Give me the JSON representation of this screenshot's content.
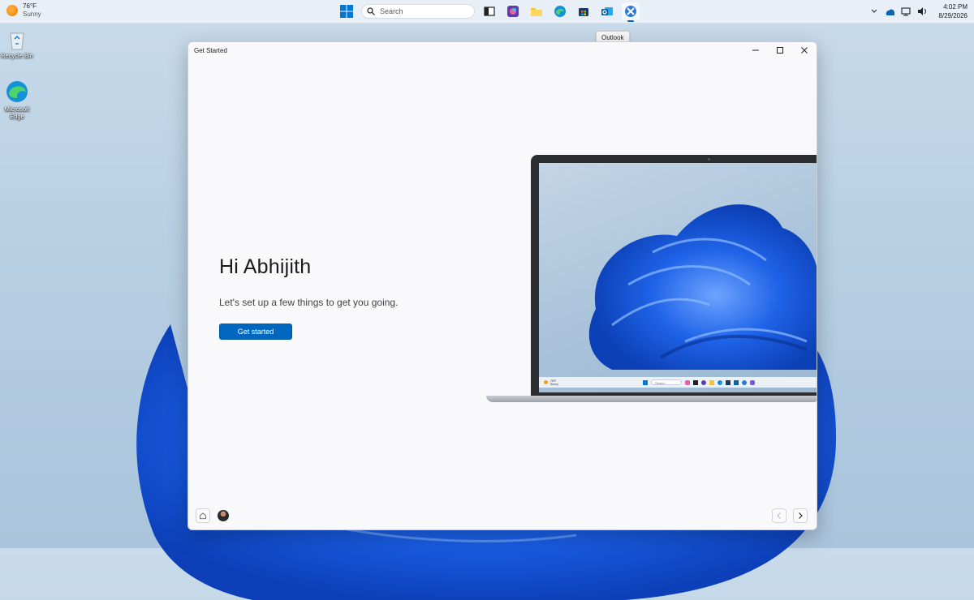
{
  "taskbar": {
    "weather": {
      "temp": "76°F",
      "condition": "Sunny"
    },
    "search": {
      "placeholder": "Search"
    },
    "clock": {
      "time": "4:02 PM",
      "date": "8/29/2026"
    },
    "tooltip": "Outlook"
  },
  "desktop": {
    "icons": [
      {
        "label": "Recycle Bin"
      },
      {
        "label": "Microsoft Edge"
      }
    ]
  },
  "window": {
    "title": "Get Started",
    "greeting": "Hi Abhijith",
    "subtitle": "Let's set up a few things to get you going.",
    "cta_label": "Get started"
  },
  "mini_screen": {
    "weather_temp": "76°F",
    "weather_condition": "Sunny",
    "search_placeholder": "Search"
  },
  "colors": {
    "accent": "#0067c0",
    "bloom": "#1a5fe6"
  }
}
